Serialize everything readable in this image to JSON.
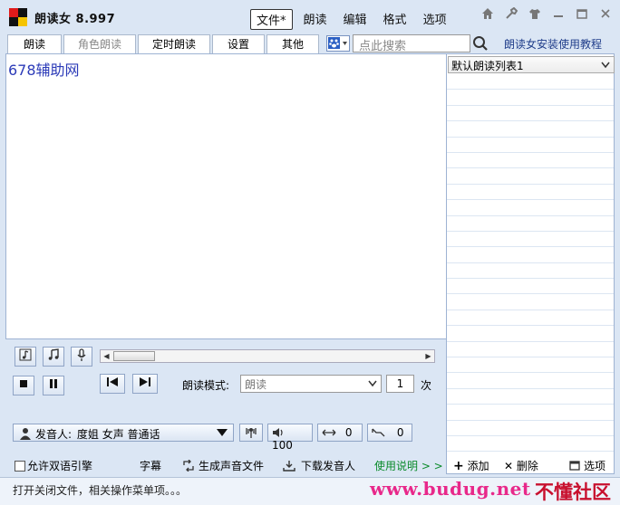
{
  "app": {
    "title": "朗读女  8.997"
  },
  "menu": [
    "文件*",
    "朗读",
    "编辑",
    "格式",
    "选项"
  ],
  "tabs": [
    "朗读",
    "角色朗读",
    "定时朗读",
    "设置",
    "其他"
  ],
  "search": {
    "placeholder": "点此搜索"
  },
  "tutorial_link": "朗读女安装使用教程",
  "editor": {
    "text": "678辅助网"
  },
  "reading_list": {
    "selected": "默认朗读列表1"
  },
  "controls": {
    "mode_label": "朗读模式:",
    "mode_value": "朗读",
    "repeat_count": "1",
    "repeat_unit": "次"
  },
  "speaker": {
    "label": "发音人:",
    "value": "度姐 女声 普通话",
    "volume": "100",
    "speed": "0",
    "pitch": "0"
  },
  "bottom": {
    "bilingual": "允许双语引擎",
    "subtitle": "字幕",
    "gen_audio": "生成声音文件",
    "download_voice": "下载发音人",
    "instructions": "使用说明 > >",
    "add": "添加",
    "delete": "删除",
    "options": "选项"
  },
  "status": {
    "text": "打开关闭文件，相关操作菜单项。。。"
  },
  "watermark": {
    "site": "www.budug.net",
    "brand": "不懂社区"
  },
  "colors": {
    "accent": "#1f3d8a",
    "editor_text": "#2c3bb8",
    "instructions": "#0a8a2a"
  }
}
